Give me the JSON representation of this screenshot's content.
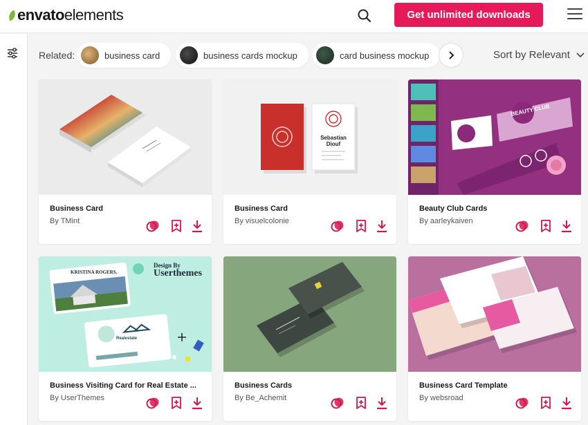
{
  "header": {
    "logo_main": "envato",
    "logo_sub": "elements",
    "cta_label": "Get unlimited downloads"
  },
  "related": {
    "label": "Related:",
    "chips": [
      {
        "label": "business card"
      },
      {
        "label": "business cards mockup"
      },
      {
        "label": "card business mockup"
      }
    ]
  },
  "sort": {
    "label": "Sort by Relevant"
  },
  "cards": [
    {
      "title": "Business Card",
      "author": "By TMint"
    },
    {
      "title": "Business Card",
      "author": "By visuelcolonie"
    },
    {
      "title": "Beauty Club Cards",
      "author": "By aarleykaiven"
    },
    {
      "title": "Business Visiting Card for Real Estate ...",
      "author": "By UserThemes"
    },
    {
      "title": "Business Cards",
      "author": "By Be_Achemit"
    },
    {
      "title": "Business Card Template",
      "author": "By websroad"
    }
  ],
  "thumb_text": {
    "sebastian_name": "Sebastian",
    "sebastian_surname": "Diouf",
    "beauty_club": "BEAUTY CLUB",
    "design_by": "Design By",
    "userthemes": "Userthemes",
    "kristina": "KRISTINA ROGERS.",
    "realestate": "Realestate"
  },
  "colors": {
    "accent": "#e6195a",
    "brand_green": "#82b541",
    "icon_red": "#d3164f"
  },
  "icons": [
    "search-icon",
    "hamburger-menu-icon",
    "filter-icon",
    "chevron-right-icon",
    "chevron-down-icon",
    "similar-items-icon",
    "add-to-collection-icon",
    "download-icon"
  ]
}
